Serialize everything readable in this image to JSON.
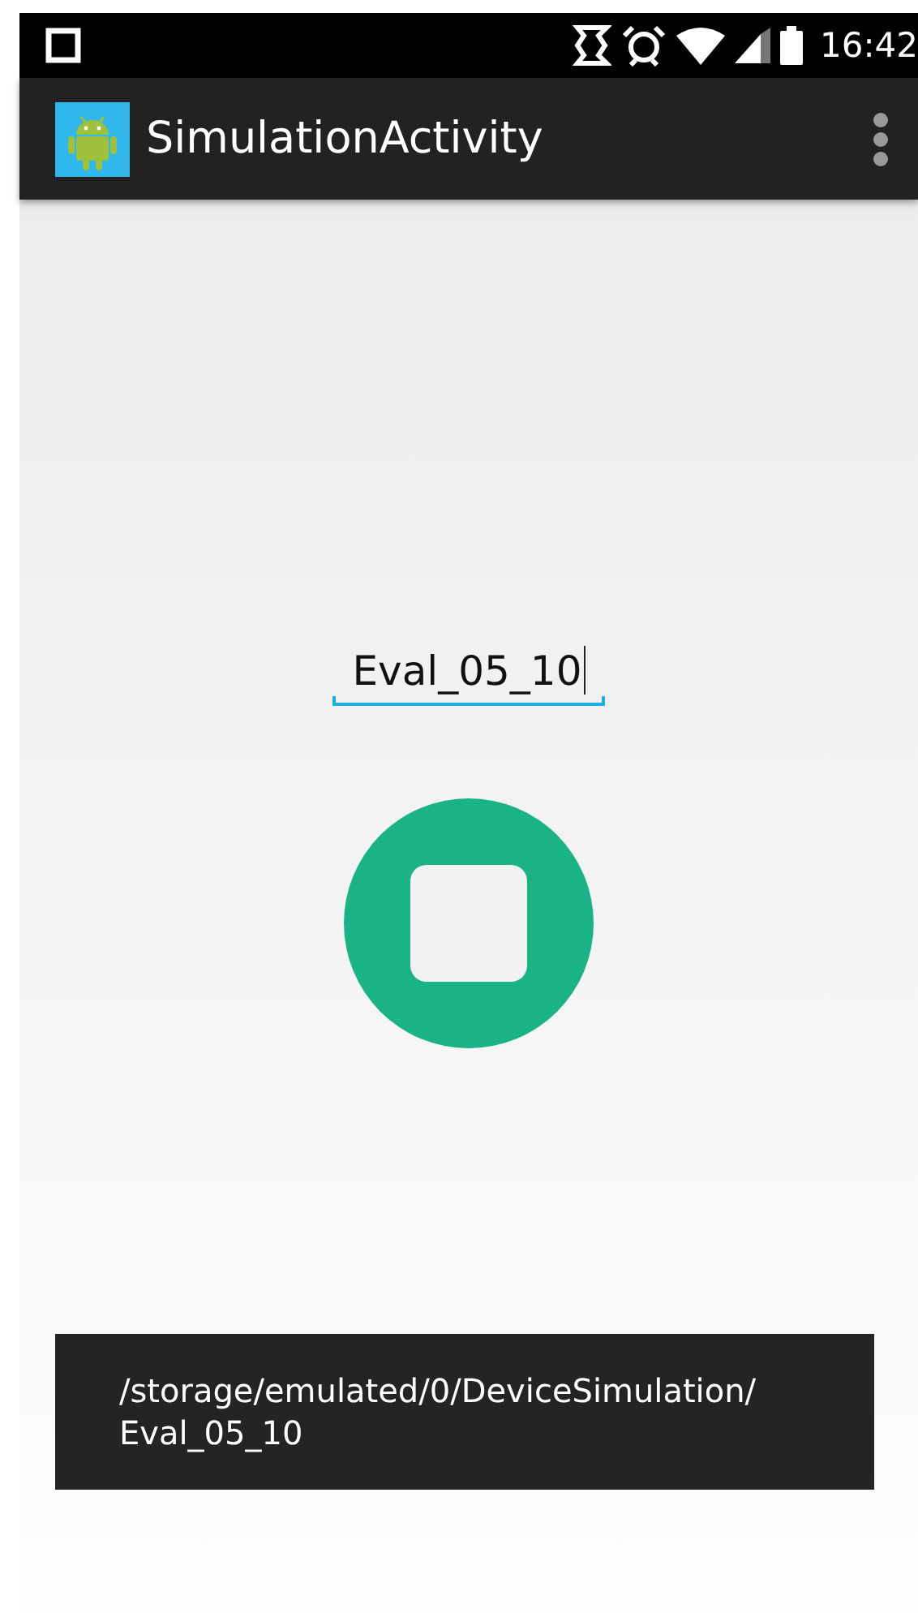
{
  "status_bar": {
    "time": "16:42"
  },
  "app_bar": {
    "title": "SimulationActivity"
  },
  "name_field": {
    "value": "Eval_05_10",
    "focused": true
  },
  "record_button": {
    "recording": true
  },
  "toast": {
    "message": "/storage/emulated/0/DeviceSimulation/Eval_05_10"
  }
}
